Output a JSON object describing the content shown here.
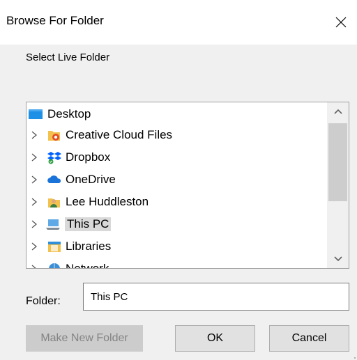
{
  "window": {
    "title": "Browse For Folder",
    "close_icon": "close-icon"
  },
  "instruction": "Select Live Folder",
  "tree": {
    "items": [
      {
        "label": "Desktop",
        "icon": "desktop-icon",
        "expandable": false,
        "selected": false
      },
      {
        "label": "Creative Cloud Files",
        "icon": "creative-cloud-folder-icon",
        "expandable": true,
        "selected": false
      },
      {
        "label": "Dropbox",
        "icon": "dropbox-icon",
        "expandable": true,
        "selected": false
      },
      {
        "label": "OneDrive",
        "icon": "onedrive-icon",
        "expandable": true,
        "selected": false
      },
      {
        "label": "Lee Huddleston",
        "icon": "user-folder-icon",
        "expandable": true,
        "selected": false
      },
      {
        "label": "This PC",
        "icon": "computer-icon",
        "expandable": true,
        "selected": true
      },
      {
        "label": "Libraries",
        "icon": "libraries-icon",
        "expandable": true,
        "selected": false
      },
      {
        "label": "Network",
        "icon": "network-icon",
        "expandable": true,
        "selected": false
      }
    ]
  },
  "folder": {
    "label": "Folder:",
    "value": "This PC"
  },
  "buttons": {
    "make_new_folder": "Make New Folder",
    "ok": "OK",
    "cancel": "Cancel"
  },
  "colors": {
    "dialog_bg": "#f0f0f0",
    "selected_bg": "#d9d9d9",
    "disabled_text": "#838383"
  }
}
